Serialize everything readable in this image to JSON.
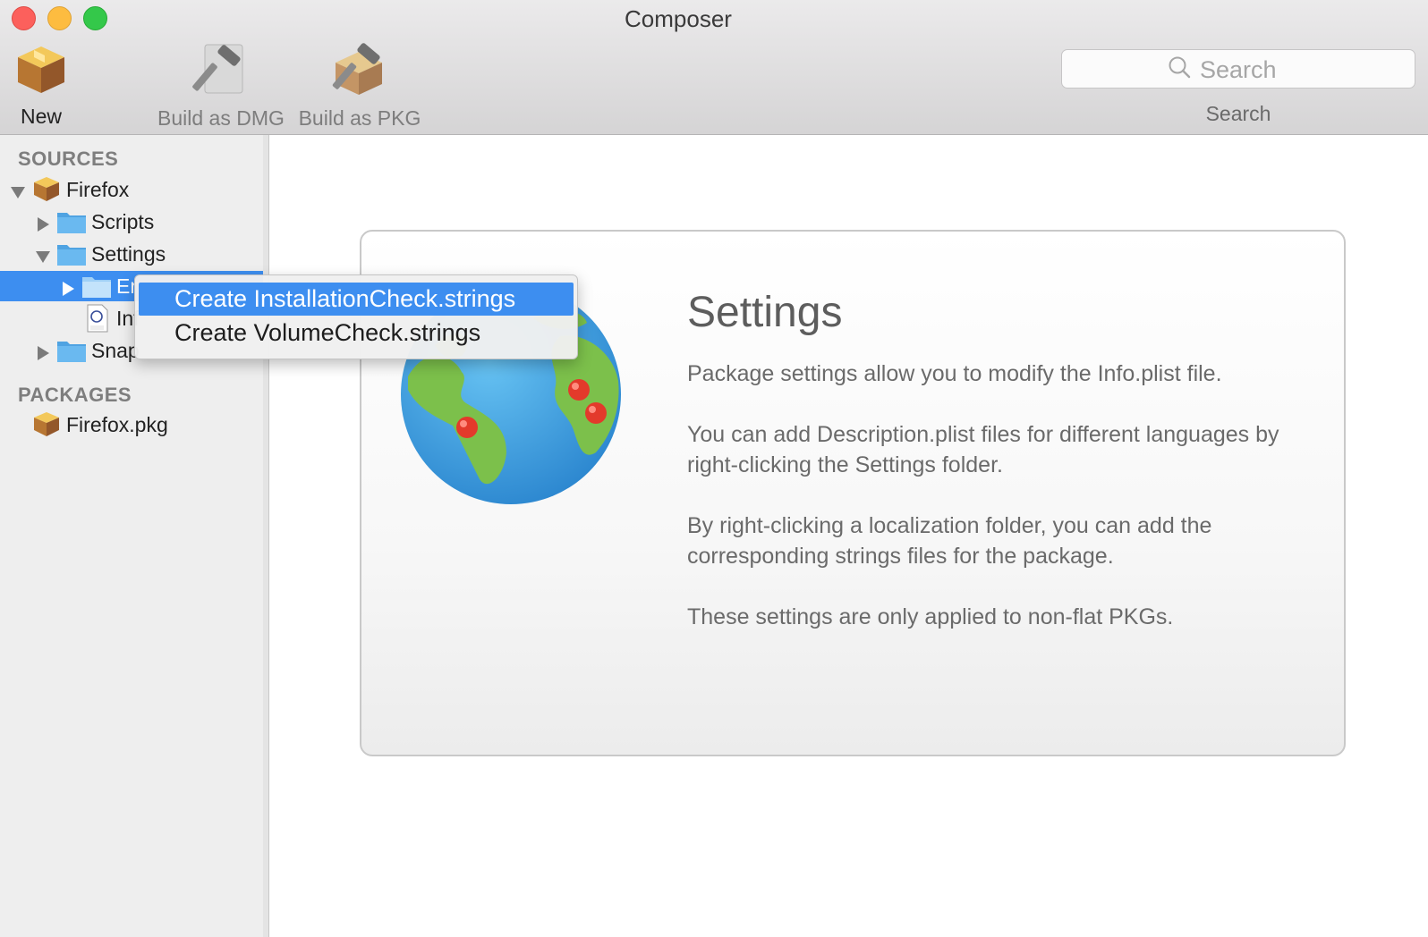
{
  "window": {
    "title": "Composer"
  },
  "toolbar": {
    "new_label": "New",
    "build_dmg_label": "Build as DMG",
    "build_pkg_label": "Build as PKG",
    "search_placeholder": "Search",
    "search_caption": "Search"
  },
  "sidebar": {
    "sources_heading": "SOURCES",
    "packages_heading": "PACKAGES",
    "tree": {
      "firefox": "Firefox",
      "scripts": "Scripts",
      "settings": "Settings",
      "localization": "En",
      "info": "Inf",
      "snapshot": "Snap"
    },
    "package_item": "Firefox.pkg",
    "selected_item": "localization"
  },
  "context_menu": {
    "items": [
      {
        "label": "Create InstallationCheck.strings",
        "highlighted": true
      },
      {
        "label": "Create VolumeCheck.strings",
        "highlighted": false
      }
    ]
  },
  "content": {
    "title": "Settings",
    "paragraphs": [
      "Package settings allow you to modify the Info.plist file.",
      "You can add Description.plist files for different languages by right-clicking the Settings folder.",
      "By right-clicking a localization folder, you can add the corresponding strings files for the package.",
      "These settings are only applied to non-flat PKGs."
    ]
  },
  "colors": {
    "selection": "#3d8ef0",
    "folder": "#5fb1ec",
    "close": "#fc605c",
    "minimize": "#fdbc40",
    "zoom": "#34c84a"
  },
  "icons": {
    "new": "package-box-icon",
    "build_dmg": "hammer-dmg-icon",
    "build_pkg": "hammer-package-icon",
    "search": "magnifier-icon",
    "folder": "folder-icon",
    "text_file": "text-file-icon",
    "globe": "globe-icon"
  }
}
